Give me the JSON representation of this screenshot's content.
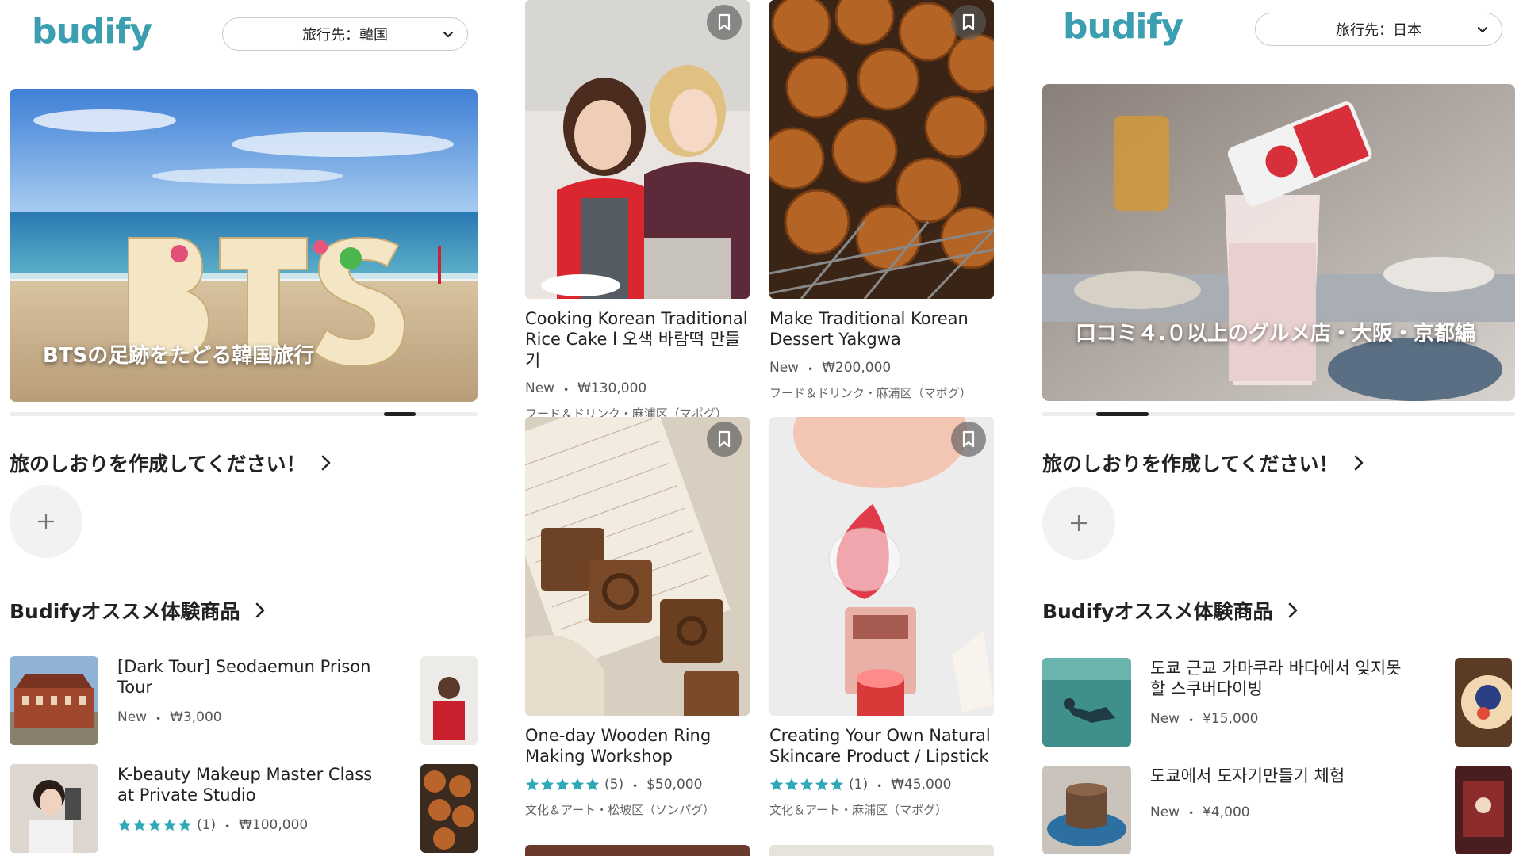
{
  "left": {
    "logo": "budify",
    "destination": "旅行先：韓国",
    "hero_caption": "BTSの足跡をたどる韓国旅行",
    "carousel_position": 0.83,
    "itinerary_title": "旅のしおりを作成してください！",
    "recommend_title": "Budifyオススメ体験商品",
    "items": [
      {
        "title": "[Dark Tour] Seodaemun Prison Tour",
        "badge": "New",
        "price": "₩3,000"
      },
      {
        "title": "K-beauty Makeup Master Class at Private Studio",
        "rating": 5,
        "reviews": "(1)",
        "price": "₩100,000"
      }
    ]
  },
  "middle": {
    "cards": [
      {
        "title": "Cooking Korean Traditional Rice Cake l 오색 바람떡 만들기",
        "badge": "New",
        "price": "₩130,000",
        "category": "フード＆ドリンク・麻浦区（マポグ）"
      },
      {
        "title": "Make Traditional Korean Dessert Yakgwa",
        "badge": "New",
        "price": "₩200,000",
        "category": "フード＆ドリンク・麻浦区（マポグ）"
      },
      {
        "title": "One-day Wooden Ring Making Workshop",
        "rating": 5,
        "reviews": "(5)",
        "price": "$50,000",
        "category": "文化＆アート・松坡区（ソンパグ）"
      },
      {
        "title": "Creating Your Own Natural Skincare Product / Lipstick",
        "rating": 5,
        "reviews": "(1)",
        "price": "₩45,000",
        "category": "文化＆アート・麻浦区（マポグ）"
      }
    ]
  },
  "right": {
    "logo": "budify",
    "destination": "旅行先：日本",
    "hero_caption": "口コミ４.０以上のグルメ店・大阪・京都編",
    "carousel_position": 0.13,
    "itinerary_title": "旅のしおりを作成してください！",
    "recommend_title": "Budifyオススメ体験商品",
    "items": [
      {
        "title": "도쿄 근교 가마쿠라 바다에서 잊지못할 스쿠버다이빙",
        "badge": "New",
        "price": "¥15,000"
      },
      {
        "title": "도쿄에서 도자기만들기 체험",
        "badge": "New",
        "price": "¥4,000"
      }
    ]
  },
  "colors": {
    "brand": "#3c9fb1",
    "star": "#2fa9b8"
  },
  "icons": [
    "chevron-down-icon",
    "chevron-right-icon",
    "plus-icon",
    "bookmark-icon",
    "star-icon"
  ]
}
